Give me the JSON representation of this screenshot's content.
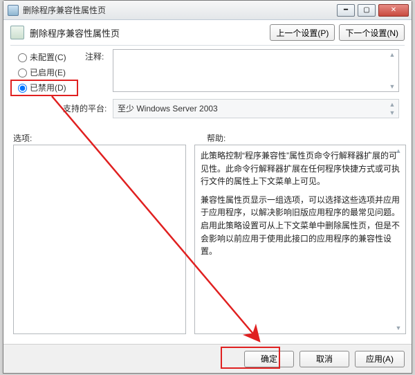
{
  "window": {
    "title": "删除程序兼容性属性页"
  },
  "header": {
    "title": "删除程序兼容性属性页",
    "prev": "上一个设置(P)",
    "next": "下一个设置(N)"
  },
  "radios": {
    "not_configured": "未配置(C)",
    "enabled": "已启用(E)",
    "disabled": "已禁用(D)"
  },
  "labels": {
    "comment": "注释:",
    "platform": "支持的平台:",
    "options": "选项:",
    "help": "帮助:"
  },
  "platform_value": "至少 Windows Server 2003",
  "help": {
    "p1": "此策略控制“程序兼容性”属性页命令行解释器扩展的可见性。此命令行解释器扩展在任何程序快捷方式或可执行文件的属性上下文菜单上可见。",
    "p2": "兼容性属性页显示一组选项，可以选择这些选项并应用于应用程序，以解决影响旧版应用程序的最常见问题。启用此策略设置可从上下文菜单中删除属性页，但是不会影响以前应用于使用此接口的应用程序的兼容性设置。"
  },
  "buttons": {
    "ok": "确定",
    "cancel": "取消",
    "apply": "应用(A)"
  }
}
